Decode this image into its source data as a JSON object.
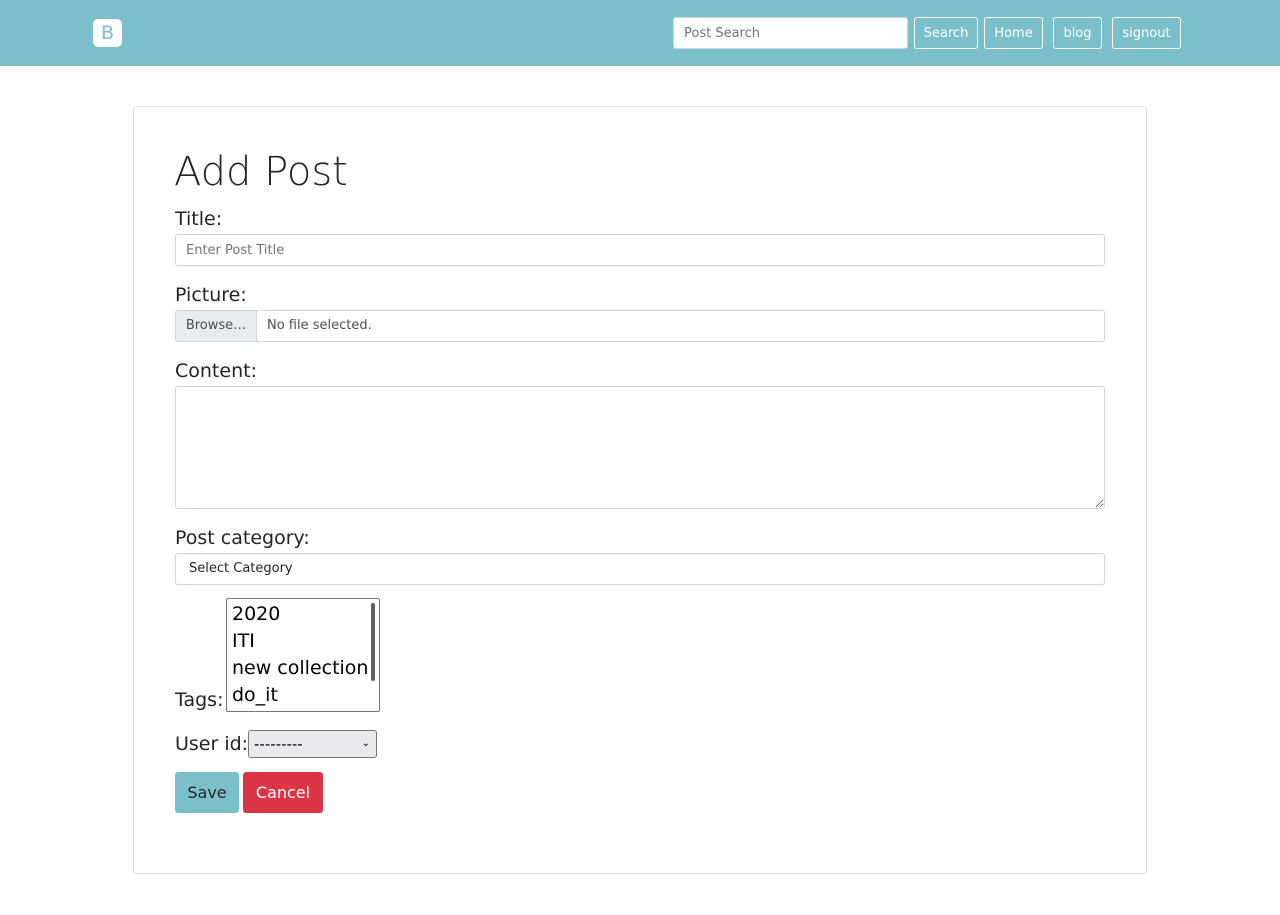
{
  "navbar": {
    "brand": "B",
    "search_placeholder": "Post Search",
    "search_button": "Search",
    "links": [
      "Home",
      "blog",
      "signout"
    ]
  },
  "form": {
    "title": "Add Post",
    "title_label": "Title:",
    "title_placeholder": "Enter Post Title",
    "picture_label": "Picture:",
    "browse_label": "Browse…",
    "file_status": "No file selected.",
    "content_label": "Content:",
    "category_label": "Post category:",
    "category_selected": "Select Category",
    "tags_label": "Tags:",
    "tags": [
      "2020",
      "ITI",
      "new collection",
      "do_it"
    ],
    "user_label": "User id:",
    "user_selected": "---------",
    "save_label": "Save",
    "cancel_label": "Cancel"
  },
  "colors": {
    "navbar": "#7bbfcb",
    "save": "#7bbfcb",
    "cancel": "#dc3545"
  }
}
